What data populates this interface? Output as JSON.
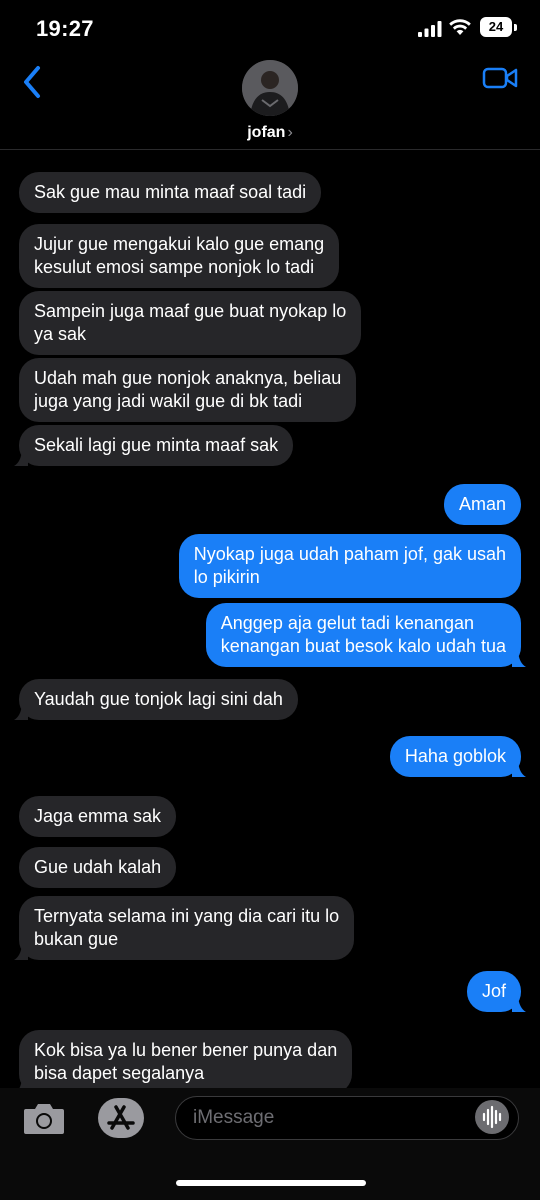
{
  "status_bar": {
    "time": "19:27",
    "battery": "24"
  },
  "header": {
    "contact_name": "jofan",
    "chevron": "›"
  },
  "messages": [
    {
      "dir": "in",
      "text": "Sak gue mau minta maaf soal tadi"
    },
    {
      "dir": "in",
      "text": "Jujur gue mengakui kalo gue emang\nkesulut emosi sampe nonjok lo tadi"
    },
    {
      "dir": "in",
      "text": "Sampein juga maaf gue buat nyokap lo\nya sak"
    },
    {
      "dir": "in",
      "text": "Udah mah gue nonjok anaknya, beliau\njuga yang jadi wakil gue di bk tadi"
    },
    {
      "dir": "in",
      "text": "Sekali lagi gue minta maaf sak"
    },
    {
      "dir": "out",
      "text": "Aman"
    },
    {
      "dir": "out",
      "text": "Nyokap juga udah paham jof, gak usah\nlo pikirin"
    },
    {
      "dir": "out",
      "text": "Anggep aja gelut tadi kenangan\nkenangan buat besok kalo udah tua"
    },
    {
      "dir": "in",
      "text": "Yaudah gue tonjok lagi sini dah"
    },
    {
      "dir": "out",
      "text": "Haha goblok"
    },
    {
      "dir": "in",
      "text": "Jaga emma sak"
    },
    {
      "dir": "in",
      "text": "Gue udah kalah"
    },
    {
      "dir": "in",
      "text": "Ternyata selama ini yang dia cari itu lo\nbukan gue"
    },
    {
      "dir": "out",
      "text": "Jof"
    },
    {
      "dir": "in",
      "text": "Kok bisa ya lu bener bener punya dan\nbisa dapet segalanya"
    }
  ],
  "input": {
    "placeholder": "iMessage"
  },
  "colors": {
    "incoming_bubble": "#262629",
    "outgoing_bubble": "#1a7ff7",
    "accent": "#1a7ff7"
  }
}
